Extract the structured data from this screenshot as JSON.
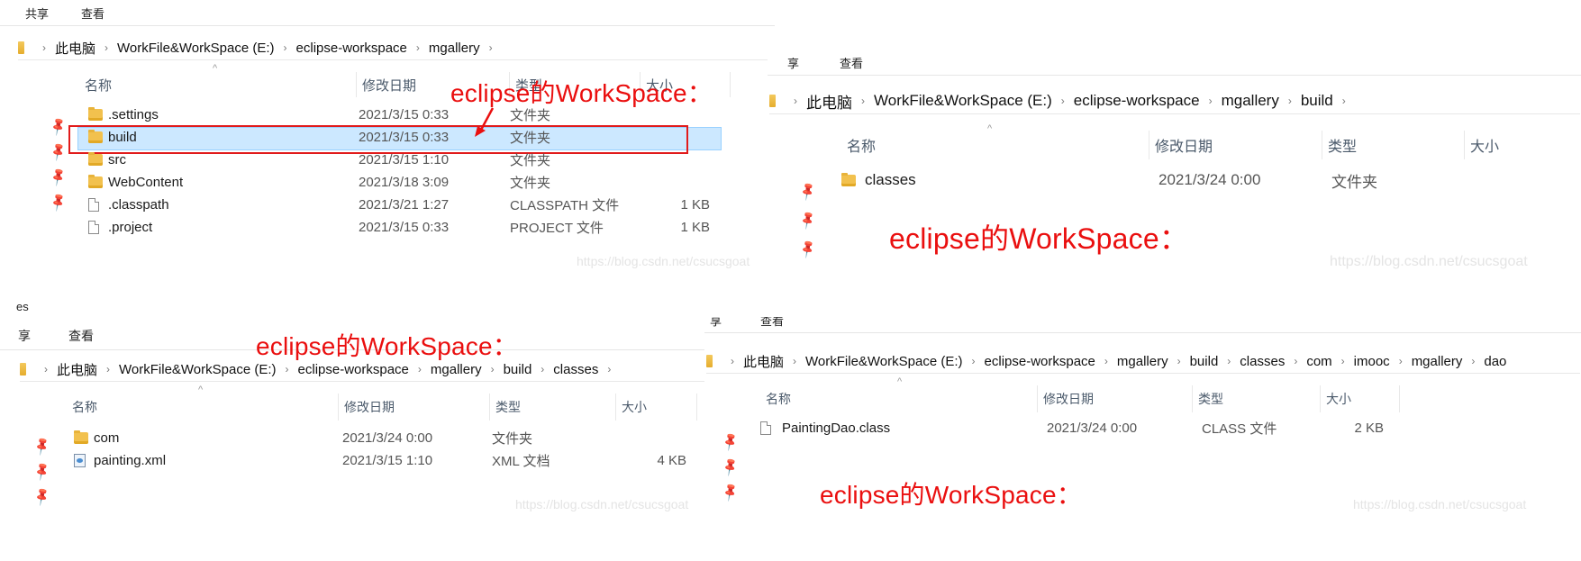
{
  "colors": {
    "annotation": "#ea0f0f",
    "selection": "#cce8ff",
    "folder": "#f2c14e"
  },
  "tabs": {
    "share_partial": "共享",
    "share_cut": "享",
    "view": "查看",
    "top_partial": "es"
  },
  "headers": {
    "name": "名称",
    "modified": "修改日期",
    "type": "类型",
    "size": "大小"
  },
  "annotation": "eclipse的WorkSpace：",
  "watermark": "https://blog.csdn.net/csucsgoat",
  "panel1": {
    "breadcrumb": [
      "此电脑",
      "WorkFile&WorkSpace (E:)",
      "eclipse-workspace",
      "mgallery"
    ],
    "rows": [
      {
        "icon": "folder-icon",
        "name": ".settings",
        "modified": "2021/3/15 0:33",
        "type": "文件夹",
        "size": ""
      },
      {
        "icon": "folder-icon",
        "name": "build",
        "modified": "2021/3/15 0:33",
        "type": "文件夹",
        "size": ""
      },
      {
        "icon": "folder-icon",
        "name": "src",
        "modified": "2021/3/15 1:10",
        "type": "文件夹",
        "size": ""
      },
      {
        "icon": "folder-icon",
        "name": "WebContent",
        "modified": "2021/3/18 3:09",
        "type": "文件夹",
        "size": ""
      },
      {
        "icon": "file-icon",
        "name": ".classpath",
        "modified": "2021/3/21 1:27",
        "type": "CLASSPATH 文件",
        "size": "1 KB"
      },
      {
        "icon": "file-icon",
        "name": ".project",
        "modified": "2021/3/15 0:33",
        "type": "PROJECT 文件",
        "size": "1 KB"
      }
    ]
  },
  "panel2": {
    "breadcrumb": [
      "此电脑",
      "WorkFile&WorkSpace (E:)",
      "eclipse-workspace",
      "mgallery",
      "build"
    ],
    "rows": [
      {
        "icon": "folder-icon",
        "name": "classes",
        "modified": "2021/3/24 0:00",
        "type": "文件夹",
        "size": ""
      }
    ]
  },
  "panel3": {
    "breadcrumb": [
      "此电脑",
      "WorkFile&WorkSpace (E:)",
      "eclipse-workspace",
      "mgallery",
      "build",
      "classes"
    ],
    "rows": [
      {
        "icon": "folder-icon",
        "name": "com",
        "modified": "2021/3/24 0:00",
        "type": "文件夹",
        "size": ""
      },
      {
        "icon": "xml-icon",
        "name": "painting.xml",
        "modified": "2021/3/15 1:10",
        "type": "XML 文档",
        "size": "4 KB"
      }
    ]
  },
  "panel4": {
    "breadcrumb": [
      "此电脑",
      "WorkFile&WorkSpace (E:)",
      "eclipse-workspace",
      "mgallery",
      "build",
      "classes",
      "com",
      "imooc",
      "mgallery",
      "dao"
    ],
    "rows": [
      {
        "icon": "file-icon",
        "name": "PaintingDao.class",
        "modified": "2021/3/24 0:00",
        "type": "CLASS 文件",
        "size": "2 KB"
      }
    ]
  }
}
